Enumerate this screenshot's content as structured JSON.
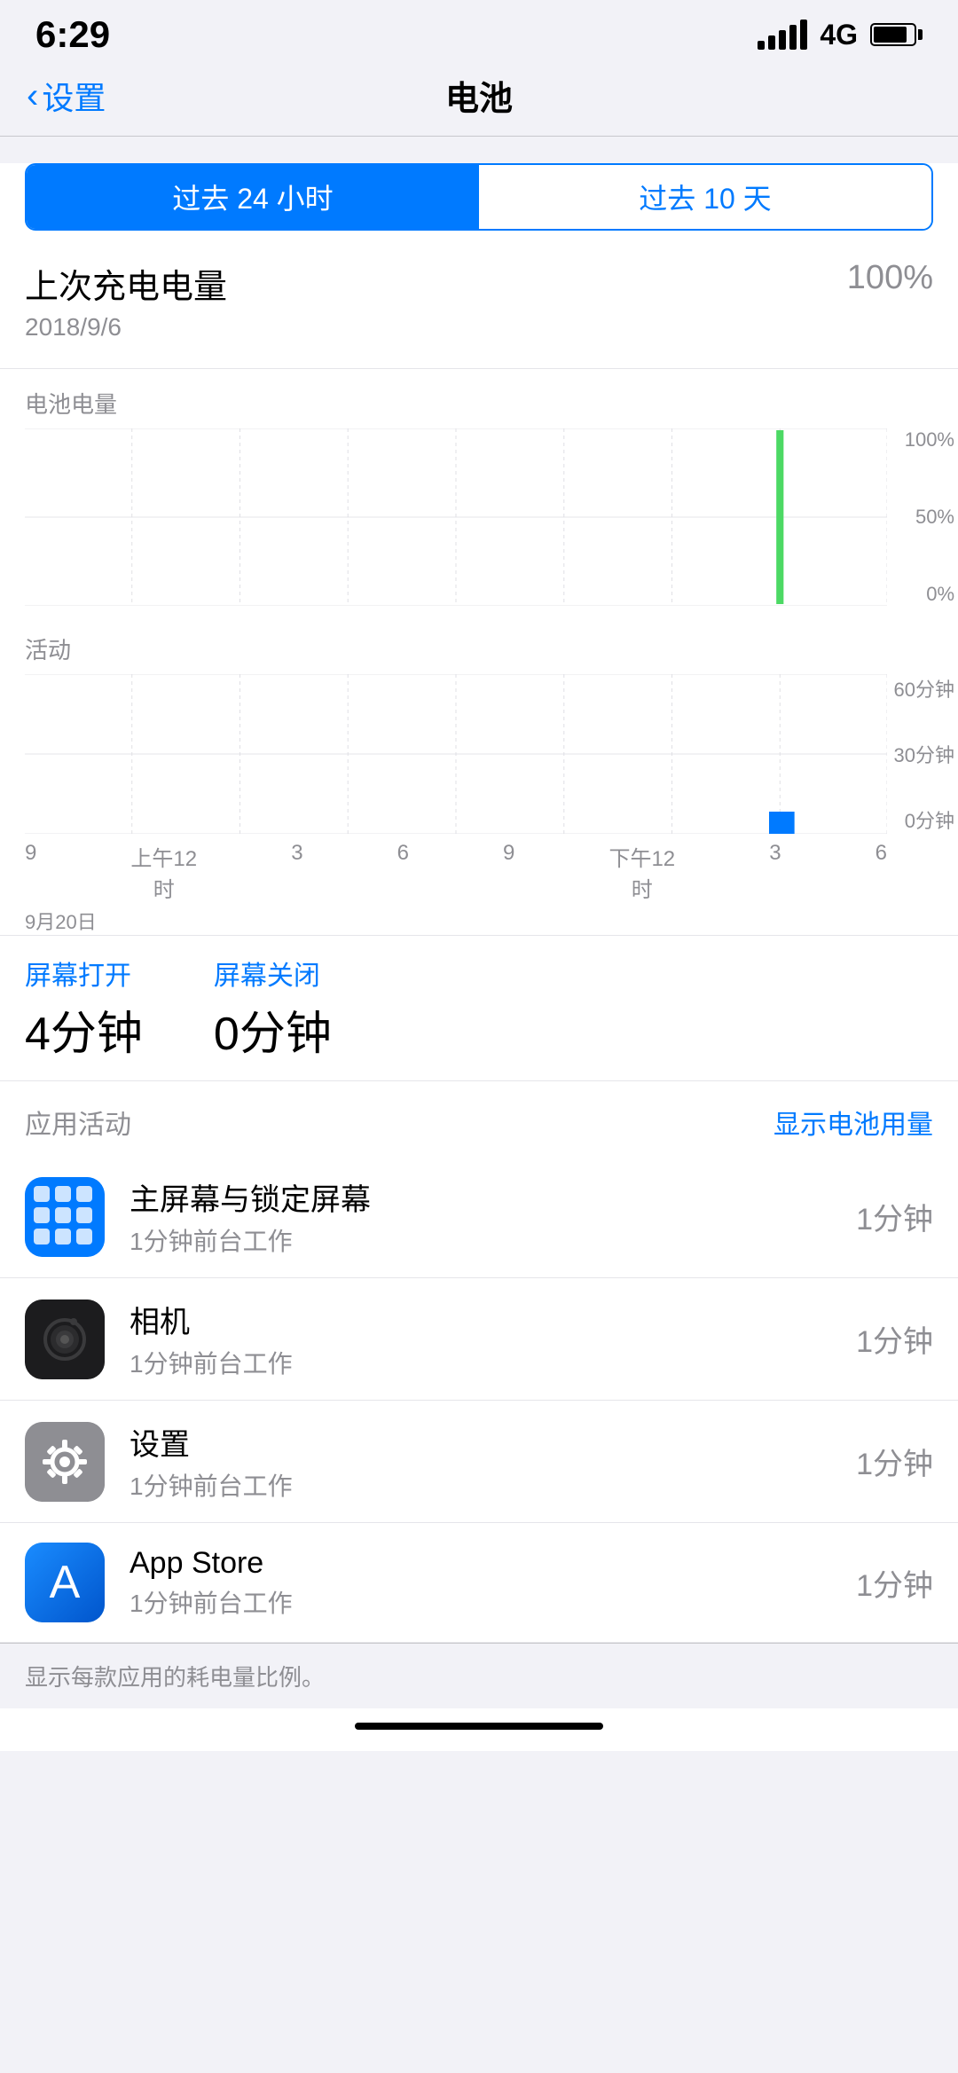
{
  "statusBar": {
    "time": "6:29",
    "signal": "4G",
    "batteryLevel": 85
  },
  "nav": {
    "backLabel": "设置",
    "title": "电池"
  },
  "tabs": [
    {
      "label": "过去 24 小时",
      "active": true
    },
    {
      "label": "过去 10 天",
      "active": false
    }
  ],
  "lastCharge": {
    "title": "上次充电电量",
    "date": "2018/9/6",
    "value": "100%"
  },
  "batteryChart": {
    "label": "电池电量",
    "yLabels": [
      "100%",
      "50%",
      "0%"
    ]
  },
  "activityChart": {
    "label": "活动",
    "yLabels": [
      "60分钟",
      "30分钟",
      "0分钟"
    ],
    "xLabels": [
      "9",
      "上午12\n时",
      "3",
      "6",
      "9",
      "下午12\n时",
      "3",
      "6"
    ],
    "dateLabel": "9月20日"
  },
  "screenTime": {
    "screenOn": {
      "label": "屏幕打开",
      "value": "4分钟"
    },
    "screenOff": {
      "label": "屏幕关闭",
      "value": "0分钟"
    }
  },
  "appActivity": {
    "title": "应用活动",
    "link": "显示电池用量",
    "apps": [
      {
        "name": "主屏幕与锁定屏幕",
        "detail": "1分钟前台工作",
        "time": "1分钟",
        "iconType": "homescreen"
      },
      {
        "name": "相机",
        "detail": "1分钟前台工作",
        "time": "1分钟",
        "iconType": "camera"
      },
      {
        "name": "设置",
        "detail": "1分钟前台工作",
        "time": "1分钟",
        "iconType": "settings"
      },
      {
        "name": "App Store",
        "detail": "1分钟前台工作",
        "time": "1分钟",
        "iconType": "appstore"
      }
    ]
  },
  "footer": {
    "note": "显示每款应用的耗电量比例。"
  }
}
